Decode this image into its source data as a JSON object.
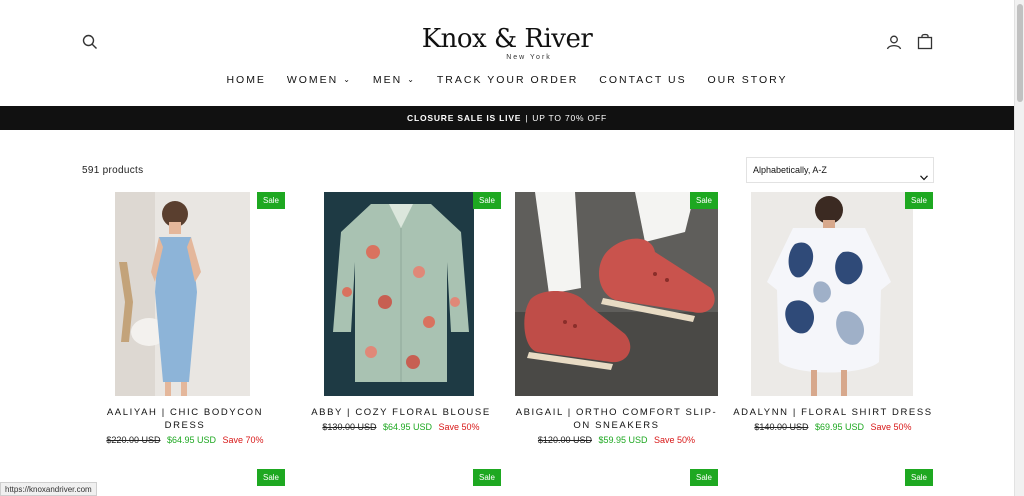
{
  "header": {
    "brand": "Knox & River",
    "tagline": "New York",
    "search_icon": "search-icon",
    "account_icon": "user-icon",
    "cart_icon": "cart-icon"
  },
  "nav": [
    {
      "label": "HOME",
      "dropdown": false
    },
    {
      "label": "WOMEN",
      "dropdown": true
    },
    {
      "label": "MEN",
      "dropdown": true
    },
    {
      "label": "TRACK YOUR ORDER",
      "dropdown": false
    },
    {
      "label": "CONTACT US",
      "dropdown": false
    },
    {
      "label": "OUR STORY",
      "dropdown": false
    }
  ],
  "announcement": {
    "bold": "CLOSURE SALE IS LIVE",
    "separator": "|",
    "rest": "UP TO 70% OFF"
  },
  "catalog": {
    "count": "591 products",
    "sort": "Alphabetically, A-Z"
  },
  "products": [
    {
      "title": "AALIYAH | CHIC BODYCON DRESS",
      "badge": "Sale",
      "old_price": "$220.00 USD",
      "new_price": "$64.95 USD",
      "save": "Save 70%"
    },
    {
      "title": "ABBY | COZY FLORAL BLOUSE",
      "badge": "Sale",
      "old_price": "$130.00 USD",
      "new_price": "$64.95 USD",
      "save": "Save 50%"
    },
    {
      "title": "ABIGAIL | ORTHO COMFORT SLIP-ON SNEAKERS",
      "badge": "Sale",
      "old_price": "$120.00 USD",
      "new_price": "$59.95 USD",
      "save": "Save 50%"
    },
    {
      "title": "ADALYNN | FLORAL SHIRT DRESS",
      "badge": "Sale",
      "old_price": "$140.00 USD",
      "new_price": "$69.95 USD",
      "save": "Save 50%"
    }
  ],
  "next_row_badges": [
    "Sale",
    "Sale",
    "Sale",
    "Sale"
  ],
  "status_url": "https://knoxandriver.com",
  "colors": {
    "sale_badge": "#1ea821",
    "save_text": "#d81818",
    "announcement_bg": "#111111"
  }
}
